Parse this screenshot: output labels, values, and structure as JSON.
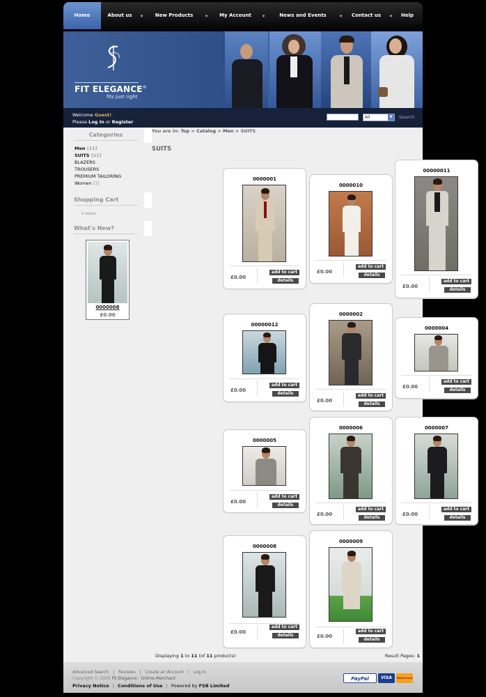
{
  "nav": {
    "items": [
      {
        "label": "Home",
        "active": true
      },
      {
        "label": "About us"
      },
      {
        "label": "New Products"
      },
      {
        "label": "My Account"
      },
      {
        "label": "News and Events"
      },
      {
        "label": "Contact us"
      },
      {
        "label": "Help"
      }
    ]
  },
  "brand": {
    "name": "FIT ELEGANCE",
    "mark": "®",
    "tagline": "fits just right"
  },
  "user": {
    "welcome": "Welcome",
    "guest": "Guest!",
    "please": "Please",
    "login": "Log In",
    "or": "or",
    "register": "Register"
  },
  "search": {
    "category": "All",
    "button": "Search"
  },
  "sidebar": {
    "categories_title": "Categories",
    "categories": [
      {
        "name": "Men",
        "count": "(11)",
        "bold": true
      },
      {
        "name": "SUITS",
        "count": "(11)",
        "bold": true
      },
      {
        "name": "BLAZERS",
        "count": ""
      },
      {
        "name": "TROUSERS",
        "count": ""
      },
      {
        "name": "PREMIUM TAILORING",
        "count": ""
      },
      {
        "name": "Women",
        "count": "(3)"
      }
    ],
    "cart_title": "Shopping Cart",
    "cart_items": "0 items",
    "new_title": "What's New?",
    "new_item": {
      "code": "0000008",
      "price": "£0.00"
    }
  },
  "breadcrumb": {
    "prefix": "You are in:",
    "parts": [
      "Top",
      "Catalog",
      "Men",
      "SUITS"
    ],
    "sep": ">"
  },
  "page_title": "SUITS",
  "products": [
    {
      "code": "0000001",
      "price": "£0.00",
      "add": "add to cart",
      "details": "details"
    },
    {
      "code": "0000010",
      "price": "£0.00",
      "add": "add to cart",
      "details": "details"
    },
    {
      "code": "00000011",
      "price": "£0.00",
      "add": "add to cart",
      "details": "details"
    },
    {
      "code": "00000012",
      "price": "£0.00",
      "add": "add to cart",
      "details": "details"
    },
    {
      "code": "0000002",
      "price": "£0.00",
      "add": "add to cart",
      "details": "details"
    },
    {
      "code": "0000004",
      "price": "£0.00",
      "add": "add to cart",
      "details": "details"
    },
    {
      "code": "0000005",
      "price": "£0.00",
      "add": "add to cart",
      "details": "details"
    },
    {
      "code": "0000006",
      "price": "£0.00",
      "add": "add to cart",
      "details": "details"
    },
    {
      "code": "0000007",
      "price": "£0.00",
      "add": "add to cart",
      "details": "details"
    },
    {
      "code": "0000008",
      "price": "£0.00",
      "add": "add to cart",
      "details": "details"
    },
    {
      "code": "0000009",
      "price": "£0.00",
      "add": "add to cart",
      "details": "details"
    }
  ],
  "listing": {
    "displaying": "Displaying",
    "from": "1",
    "to_word": "to",
    "to": "11",
    "of_open": "(of",
    "total": "11",
    "of_close": "products)",
    "result_pages": "Result Pages:",
    "current_page": "1"
  },
  "footer": {
    "links": [
      "Advanced Search",
      "|",
      "Reviews",
      "|",
      "Create an Account",
      "|",
      "Log In"
    ],
    "copyright": "Copyright © 2009",
    "company": "Fit Elegance : Online Merchant",
    "privacy": "Privacy Notice",
    "conditions": "Conditions of Use",
    "powered": "Powered by",
    "powered_by": "FSB Limited",
    "payments": [
      "PayPal",
      "VISA",
      "MasterCard"
    ]
  },
  "colors": {
    "accent": "#3c64a9",
    "nav": "#111111",
    "bar": "#16213a",
    "guest": "#e0b060"
  }
}
